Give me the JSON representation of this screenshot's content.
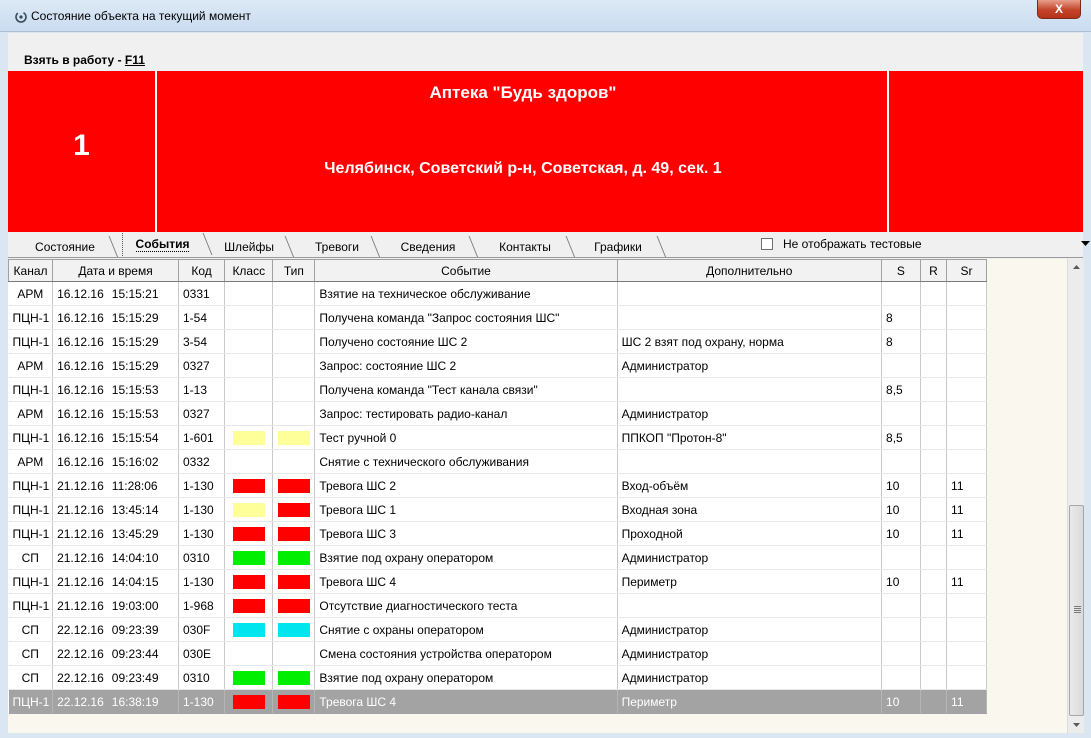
{
  "window": {
    "title": "Состояние объекта на текущий момент",
    "close_label": "X"
  },
  "menu": {
    "take_to_work_prefix": "Взять в работу - ",
    "take_to_work_key": "F11"
  },
  "banner": {
    "number": "1",
    "name": "Аптека \"Будь здоров\"",
    "address": "Челябинск, Советский р-н, Советская, д. 49, сек. 1",
    "color": "#ff0000"
  },
  "tabs": [
    {
      "label": "Состояние",
      "active": false
    },
    {
      "label": "События",
      "active": true
    },
    {
      "label": "Шлейфы",
      "active": false
    },
    {
      "label": "Тревоги",
      "active": false
    },
    {
      "label": "Сведения",
      "active": false
    },
    {
      "label": "Контакты",
      "active": false
    },
    {
      "label": "Графики",
      "active": false
    }
  ],
  "filter": {
    "hide_test_label": "Не отображать тестовые",
    "hide_test_checked": false
  },
  "columns": [
    "Канал",
    "Дата и время",
    "Код",
    "Класс",
    "Тип",
    "Событие",
    "Дополнительно",
    "S",
    "R",
    "Sr"
  ],
  "colors": {
    "red": "#ff0000",
    "yellow": "#ffff99",
    "green": "#00ee00",
    "cyan": "#00e5ee",
    "selection": "#a3a3a3"
  },
  "rows": [
    {
      "channel": "АРМ",
      "date": "16.12.16",
      "time": "15:15:21",
      "code": "0331",
      "class_color": "",
      "type_color": "",
      "event": "Взятие на техническое обслуживание",
      "extra": "",
      "s": "",
      "r": "",
      "sr": ""
    },
    {
      "channel": "ПЦН-1",
      "date": "16.12.16",
      "time": "15:15:29",
      "code": "1-54",
      "class_color": "",
      "type_color": "",
      "event": "Получена команда \"Запрос состояния ШС\"",
      "extra": "",
      "s": "8",
      "r": "",
      "sr": ""
    },
    {
      "channel": "ПЦН-1",
      "date": "16.12.16",
      "time": "15:15:29",
      "code": "3-54",
      "class_color": "",
      "type_color": "",
      "event": "Получено состояние ШС 2",
      "extra": "ШС 2 взят под охрану, норма",
      "s": "8",
      "r": "",
      "sr": ""
    },
    {
      "channel": "АРМ",
      "date": "16.12.16",
      "time": "15:15:29",
      "code": "0327",
      "class_color": "",
      "type_color": "",
      "event": "Запрос: состояние ШС 2",
      "extra": "Администратор",
      "s": "",
      "r": "",
      "sr": ""
    },
    {
      "channel": "ПЦН-1",
      "date": "16.12.16",
      "time": "15:15:53",
      "code": "1-13",
      "class_color": "",
      "type_color": "",
      "event": "Получена команда \"Тест канала связи\"",
      "extra": "",
      "s": "8,5",
      "r": "",
      "sr": ""
    },
    {
      "channel": "АРМ",
      "date": "16.12.16",
      "time": "15:15:53",
      "code": "0327",
      "class_color": "",
      "type_color": "",
      "event": "Запрос: тестировать радио-канал",
      "extra": "Администратор",
      "s": "",
      "r": "",
      "sr": ""
    },
    {
      "channel": "ПЦН-1",
      "date": "16.12.16",
      "time": "15:15:54",
      "code": "1-601",
      "class_color": "yellow",
      "type_color": "yellow",
      "event": "Тест ручной 0",
      "extra": "ППКОП \"Протон-8\"",
      "s": "8,5",
      "r": "",
      "sr": ""
    },
    {
      "channel": "АРМ",
      "date": "16.12.16",
      "time": "15:16:02",
      "code": "0332",
      "class_color": "",
      "type_color": "",
      "event": "Снятие с технического обслуживания",
      "extra": "",
      "s": "",
      "r": "",
      "sr": ""
    },
    {
      "channel": "ПЦН-1",
      "date": "21.12.16",
      "time": "11:28:06",
      "code": "1-130",
      "class_color": "red",
      "type_color": "red",
      "event": "Тревога ШС 2",
      "extra": "Вход-объём",
      "s": "10",
      "r": "",
      "sr": "11"
    },
    {
      "channel": "ПЦН-1",
      "date": "21.12.16",
      "time": "13:45:14",
      "code": "1-130",
      "class_color": "yellow",
      "type_color": "red",
      "event": "Тревога ШС 1",
      "extra": "Входная зона",
      "s": "10",
      "r": "",
      "sr": "11"
    },
    {
      "channel": "ПЦН-1",
      "date": "21.12.16",
      "time": "13:45:29",
      "code": "1-130",
      "class_color": "red",
      "type_color": "red",
      "event": "Тревога ШС 3",
      "extra": "Проходной",
      "s": "10",
      "r": "",
      "sr": "11"
    },
    {
      "channel": "СП",
      "date": "21.12.16",
      "time": "14:04:10",
      "code": "0310",
      "class_color": "green",
      "type_color": "green",
      "event": "Взятие под охрану оператором",
      "extra": "Администратор",
      "s": "",
      "r": "",
      "sr": ""
    },
    {
      "channel": "ПЦН-1",
      "date": "21.12.16",
      "time": "14:04:15",
      "code": "1-130",
      "class_color": "red",
      "type_color": "red",
      "event": "Тревога ШС 4",
      "extra": "Периметр",
      "s": "10",
      "r": "",
      "sr": "11"
    },
    {
      "channel": "ПЦН-1",
      "date": "21.12.16",
      "time": "19:03:00",
      "code": "1-968",
      "class_color": "red",
      "type_color": "red",
      "event": "Отсутствие диагностического теста",
      "extra": "",
      "s": "",
      "r": "",
      "sr": ""
    },
    {
      "channel": "СП",
      "date": "22.12.16",
      "time": "09:23:39",
      "code": "030F",
      "class_color": "cyan",
      "type_color": "cyan",
      "event": "Снятие с охраны оператором",
      "extra": "Администратор",
      "s": "",
      "r": "",
      "sr": ""
    },
    {
      "channel": "СП",
      "date": "22.12.16",
      "time": "09:23:44",
      "code": "030E",
      "class_color": "",
      "type_color": "",
      "event": "Смена состояния устройства оператором",
      "extra": "Администратор",
      "s": "",
      "r": "",
      "sr": ""
    },
    {
      "channel": "СП",
      "date": "22.12.16",
      "time": "09:23:49",
      "code": "0310",
      "class_color": "green",
      "type_color": "green",
      "event": "Взятие под охрану оператором",
      "extra": "Администратор",
      "s": "",
      "r": "",
      "sr": ""
    },
    {
      "channel": "ПЦН-1",
      "date": "22.12.16",
      "time": "16:38:19",
      "code": "1-130",
      "class_color": "red",
      "type_color": "red",
      "event": "Тревога ШС 4",
      "extra": "Периметр",
      "s": "10",
      "r": "",
      "sr": "11",
      "selected": true
    }
  ]
}
